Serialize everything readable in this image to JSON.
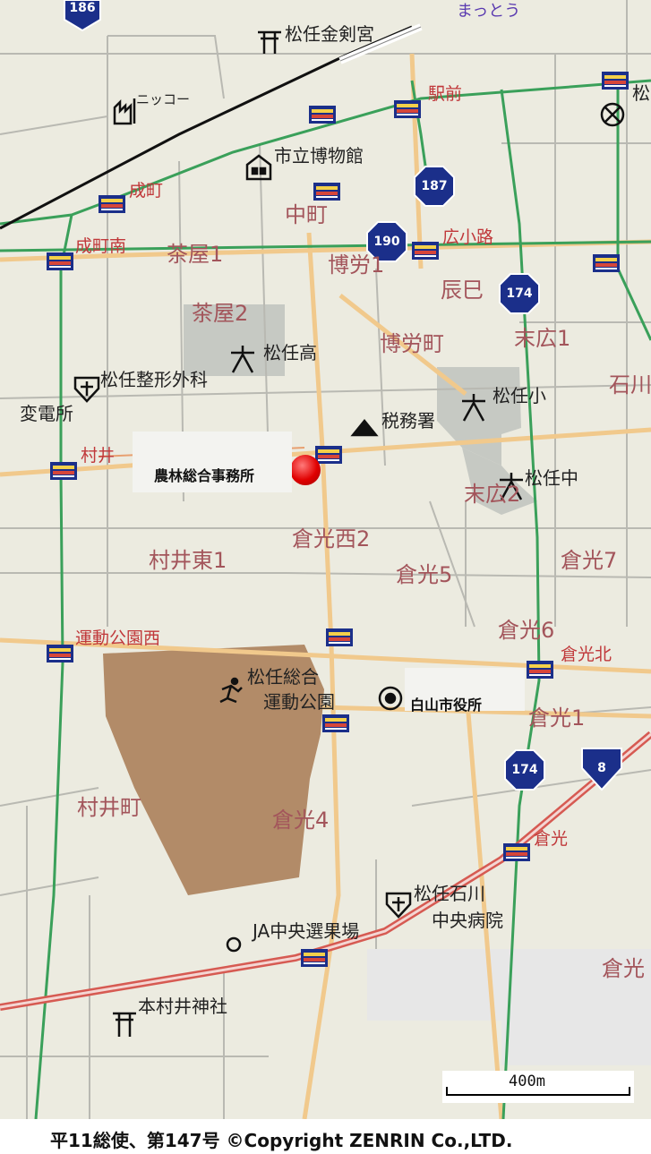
{
  "map": {
    "colors": {
      "background": "#ecebe0",
      "block_line": "#b9b9b2",
      "road_orange": "#f1c98c",
      "rail_green": "#3aa05a",
      "expressway_red": "#d65a52",
      "park": "#b28b68",
      "school_grounds": "#c6c9c3",
      "station_label": "#c0383a",
      "place_label": "#a3555b",
      "route_shield": "#1b2f8a"
    },
    "highlight_callouts": [
      {
        "id": "noribayashi",
        "label": "農林総合事務所"
      },
      {
        "id": "cityhall",
        "label": "白山市役所"
      }
    ],
    "place_names": [
      "茶屋1",
      "茶屋2",
      "中町",
      "博労1",
      "辰巳",
      "博労町",
      "末広1",
      "石川",
      "末広2",
      "倉光西2",
      "村井東1",
      "倉光5",
      "倉光7",
      "倉光6",
      "倉光北",
      "倉光1",
      "村井町",
      "倉光4",
      "倉光"
    ],
    "station_labels": [
      "駅前",
      "成町",
      "成町南",
      "広小路",
      "村井",
      "運動公園西",
      "倉光"
    ],
    "facilities": [
      "松任金剣宮",
      "ニッコー",
      "市立博物館",
      "松任高",
      "松任整形外科",
      "変電所",
      "税務署",
      "松任小",
      "松任中",
      "松任総合",
      "運動公園",
      "松任石川",
      "中央病院",
      "JA中央選果場",
      "本村井神社",
      "まっとう",
      "松"
    ],
    "route_shields": [
      "186",
      "187",
      "190",
      "174",
      "174",
      "8"
    ],
    "scale": {
      "label": "400m"
    },
    "copyright": "平11総使、第147号 ©Copyright ZENRIN Co.,LTD.",
    "icons": [
      "shrine-icon",
      "factory-icon",
      "museum-icon",
      "school-icon",
      "hospital-icon",
      "tax-office-icon",
      "city-hall-icon",
      "sports-park-icon",
      "market-icon",
      "post-office-icon",
      "station-icon",
      "route-shield-icon",
      "location-marker-icon"
    ]
  }
}
